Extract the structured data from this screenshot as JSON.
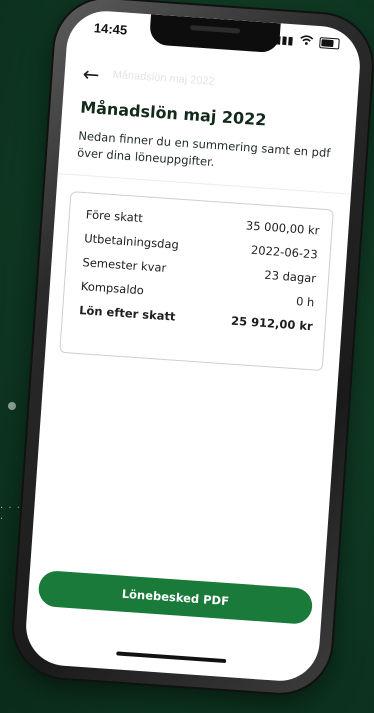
{
  "status_bar": {
    "time": "14:45",
    "signal": "▮▮▮",
    "wifi": "wifi-icon",
    "battery": "battery-icon"
  },
  "nav": {
    "back_icon": "←",
    "faded_title": "Månadslön maj 2022"
  },
  "page": {
    "title": "Månadslön maj 2022",
    "intro": "Nedan finner du en summering samt en pdf över dina löneuppgifter."
  },
  "summary": {
    "rows": [
      {
        "label": "Före skatt",
        "value": "35 000,00 kr"
      },
      {
        "label": "Utbetalningsdag",
        "value": "2022-06-23"
      },
      {
        "label": "Semester kvar",
        "value": "23 dagar"
      },
      {
        "label": "Kompsaldo",
        "value": "0 h"
      }
    ],
    "total": {
      "label": "Lön efter skatt",
      "value": "25 912,00 kr"
    }
  },
  "actions": {
    "pdf_button_label": "Lönebesked PDF"
  },
  "decor": {
    "dots": "· · · · ·"
  },
  "colors": {
    "background": "#0f3a23",
    "accent": "#1a7a3a"
  }
}
